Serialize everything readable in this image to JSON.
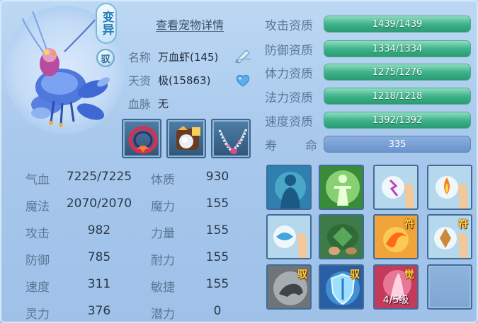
{
  "pet": {
    "badge_mutant": "变异",
    "badge_tame": "驭",
    "detail_link": "查看宠物详情",
    "name_label": "名称",
    "name_value": "万血虾(145)",
    "talent_label": "天资",
    "talent_value": "极(15863)",
    "bloodline_label": "血脉",
    "bloodline_value": "无"
  },
  "equipment": [
    {
      "name": "collar"
    },
    {
      "name": "armor"
    },
    {
      "name": "necklace"
    }
  ],
  "stats": [
    {
      "label": "气血",
      "value": "7225/7225",
      "label2": "体质",
      "value2": "930"
    },
    {
      "label": "魔法",
      "value": "2070/2070",
      "label2": "魔力",
      "value2": "155"
    },
    {
      "label": "攻击",
      "value": "982",
      "label2": "力量",
      "value2": "155"
    },
    {
      "label": "防御",
      "value": "785",
      "label2": "耐力",
      "value2": "155"
    },
    {
      "label": "速度",
      "value": "311",
      "label2": "敏捷",
      "value2": "155"
    },
    {
      "label": "灵力",
      "value": "376",
      "label2": "潜力",
      "value2": "0"
    }
  ],
  "aptitudes": [
    {
      "label": "攻击资质",
      "text": "1439/1439",
      "fraction": 1.0
    },
    {
      "label": "防御资质",
      "text": "1334/1334",
      "fraction": 1.0
    },
    {
      "label": "体力资质",
      "text": "1275/1276",
      "fraction": 0.999
    },
    {
      "label": "法力资质",
      "text": "1218/1218",
      "fraction": 1.0
    },
    {
      "label": "速度资质",
      "text": "1392/1392",
      "fraction": 1.0
    }
  ],
  "lifespan": {
    "label_a": "寿",
    "label_b": "命",
    "value": "335"
  },
  "skills": [
    {
      "name": "skill-silhouette-icon"
    },
    {
      "name": "skill-light-figure-icon"
    },
    {
      "name": "skill-lightning-hand-icon"
    },
    {
      "name": "skill-fire-hand-icon"
    },
    {
      "name": "skill-water-hand-icon"
    },
    {
      "name": "skill-turtle-icon"
    },
    {
      "name": "skill-fire-swirl-icon",
      "tag": "符"
    },
    {
      "name": "skill-rune-hand-icon",
      "tag": "符"
    },
    {
      "name": "skill-beast-icon",
      "tag": "驭"
    },
    {
      "name": "skill-shield-icon",
      "tag": "驭"
    },
    {
      "name": "skill-awaken-icon",
      "tag": "觉",
      "level": "4/5级"
    },
    {
      "name": "skill-empty-slot"
    }
  ],
  "colors": {
    "bar_green": "#3fb389",
    "bar_blue": "#6b93cc",
    "label_blue": "#5b7795",
    "value_dark": "#2a3a4c"
  }
}
